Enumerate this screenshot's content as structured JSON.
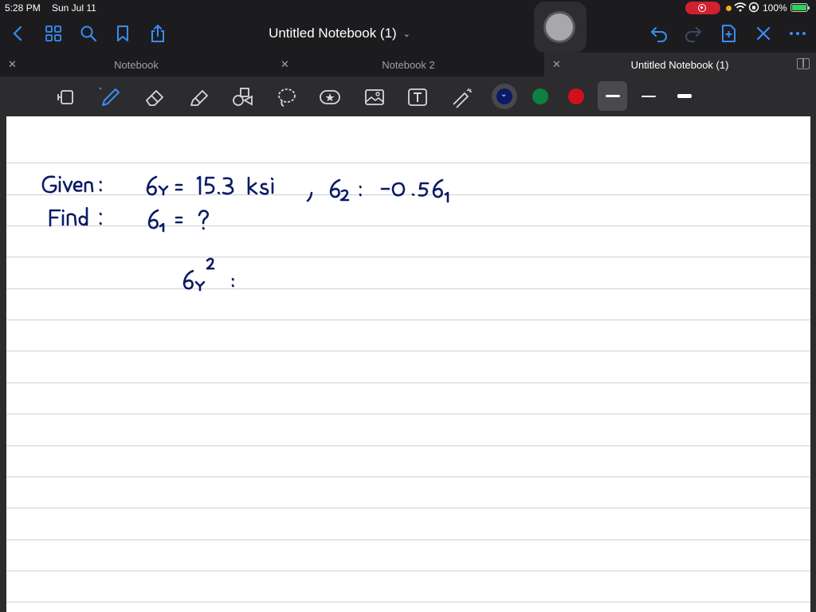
{
  "status_bar": {
    "time": "5:28 PM",
    "date": "Sun Jul 11",
    "battery": "100%",
    "record_color": "#d3202f"
  },
  "nav_bar": {
    "title": "Untitled Notebook (1)",
    "left_icons": [
      "back-chevron-icon",
      "grid-icon",
      "search-icon",
      "bookmark-icon",
      "share-icon"
    ],
    "right_icons": [
      "undo-icon",
      "redo-icon",
      "add-page-icon",
      "close-icon",
      "more-icon"
    ],
    "accent": "#3b8cf7"
  },
  "tabs": [
    {
      "label": "Notebook",
      "active": false
    },
    {
      "label": "Notebook 2",
      "active": false
    },
    {
      "label": "Untitled Notebook (1)",
      "active": true
    }
  ],
  "toolbar": {
    "tools": [
      "page-view-icon",
      "pen-icon",
      "eraser-icon",
      "highlighter-icon",
      "shapes-icon",
      "lasso-icon",
      "sticker-icon",
      "image-icon",
      "text-icon",
      "laser-pointer-icon"
    ],
    "active_tool": "pen-icon",
    "colors": [
      "#0b1a66",
      "#0e7f3f",
      "#d0101a"
    ],
    "selected_color": "#0b1a66",
    "thicknesses": [
      "fine",
      "medium",
      "thick"
    ],
    "selected_thickness": "fine"
  },
  "page": {
    "background": "#ffffff",
    "ink_color": "#0b1a66",
    "handwriting_lines": [
      "Given :   6ᵧ = 15.3 ksi  ,  6₂ : -0.5 6₁",
      "Find :   6₁ = ?",
      "6ᵧ² :"
    ]
  }
}
